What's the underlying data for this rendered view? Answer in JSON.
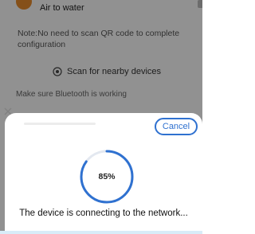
{
  "background": {
    "device_name": "Air to water",
    "note": "Note:No need to scan QR code to complete configuration",
    "scan_label": "Scan for nearby devices",
    "bluetooth_tip": "Make sure Bluetooth is working"
  },
  "sheet": {
    "cancel_label": "Cancel",
    "progress_text": "85%",
    "progress_fraction": 0.85,
    "status_message": "The device is connecting to the network..."
  },
  "colors": {
    "accent": "#2f71d0",
    "progress_track": "#e3e8f0",
    "device_icon": "#e58b2c"
  }
}
